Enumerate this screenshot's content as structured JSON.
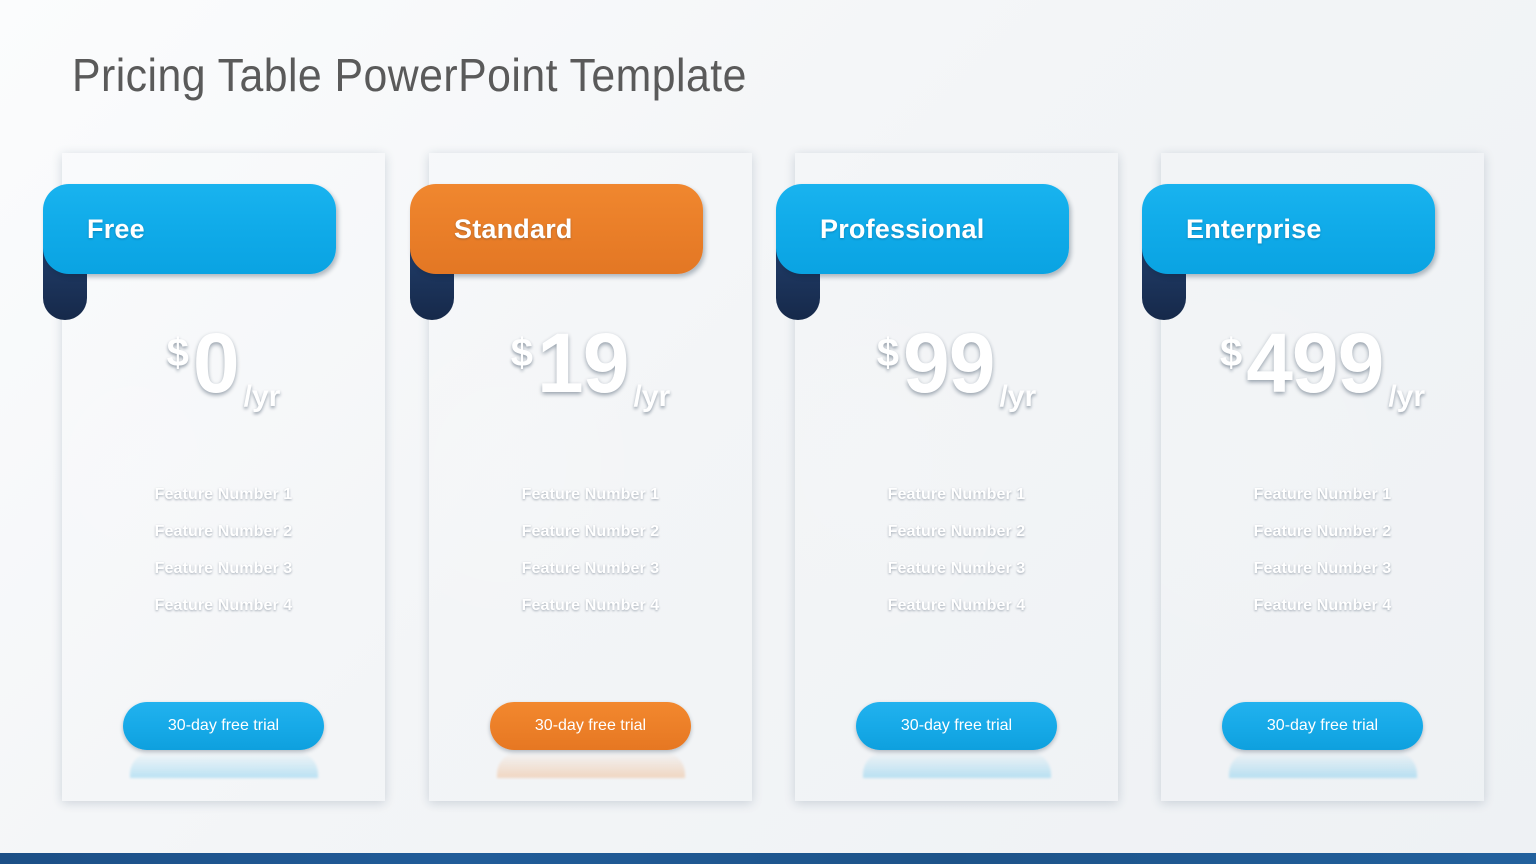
{
  "title": "Pricing Table PowerPoint Template",
  "colors": {
    "accent_cyan": "#10abe9",
    "accent_orange": "#ea7f29",
    "card_blue": "#1f5b92",
    "fold_navy": "#1b3258",
    "title_gray": "#5a5a5a",
    "background": "#f3f5f7"
  },
  "plans": [
    {
      "name": "Free",
      "theme": "cyan",
      "currency": "$",
      "amount": "0",
      "period": "/yr",
      "features": [
        "Feature Number 1",
        "Feature Number 2",
        "Feature Number 3",
        "Feature Number 4"
      ],
      "cta": "30-day free trial"
    },
    {
      "name": "Standard",
      "theme": "orange",
      "currency": "$",
      "amount": "19",
      "period": "/yr",
      "features": [
        "Feature Number 1",
        "Feature Number 2",
        "Feature Number 3",
        "Feature Number 4"
      ],
      "cta": "30-day free trial"
    },
    {
      "name": "Professional",
      "theme": "cyan",
      "currency": "$",
      "amount": "99",
      "period": "/yr",
      "features": [
        "Feature Number 1",
        "Feature Number 2",
        "Feature Number 3",
        "Feature Number 4"
      ],
      "cta": "30-day free trial"
    },
    {
      "name": "Enterprise",
      "theme": "cyan",
      "currency": "$",
      "amount": "499",
      "period": "/yr",
      "features": [
        "Feature Number 1",
        "Feature Number 2",
        "Feature Number 3",
        "Feature Number 4"
      ],
      "cta": "30-day free trial"
    }
  ]
}
